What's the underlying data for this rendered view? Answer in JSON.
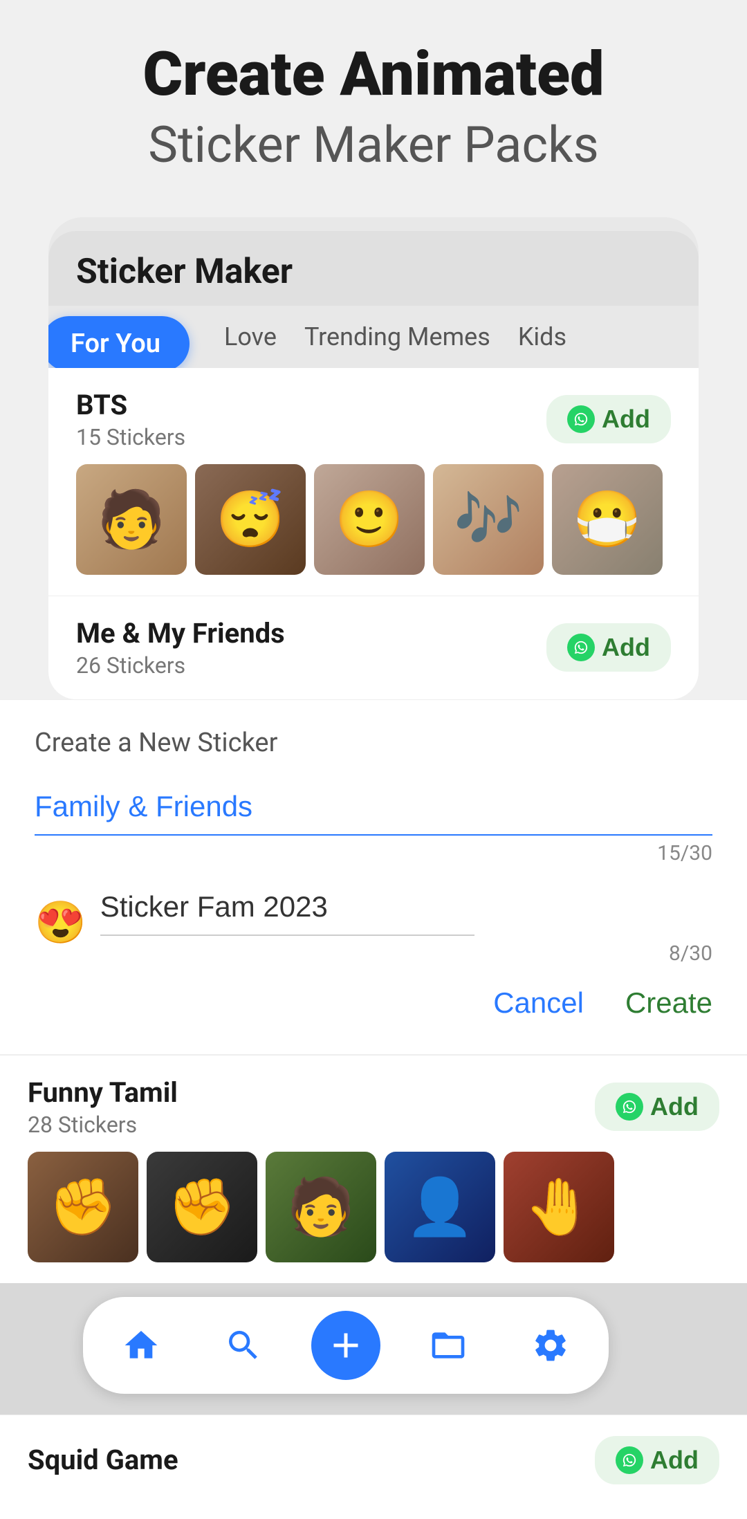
{
  "header": {
    "title_line1": "Create Animated",
    "title_line2": "Sticker Maker Packs"
  },
  "app": {
    "title": "Sticker Maker",
    "tabs": [
      {
        "id": "foryou",
        "label": "For You",
        "active": true
      },
      {
        "id": "love",
        "label": "Love",
        "active": false
      },
      {
        "id": "trending",
        "label": "Trending Memes",
        "active": false
      },
      {
        "id": "kids",
        "label": "Kids",
        "active": false
      }
    ]
  },
  "packs": [
    {
      "id": "bts",
      "name": "BTS",
      "count": "15 Stickers",
      "add_label": "Add",
      "stickers": [
        "face1",
        "face2",
        "face3",
        "face4",
        "face5"
      ]
    },
    {
      "id": "me-friends",
      "name": "Me & My Friends",
      "count": "26 Stickers",
      "add_label": "Add"
    },
    {
      "id": "funny-tamil",
      "name": "Funny Tamil",
      "count": "28 Stickers",
      "add_label": "Add",
      "stickers": [
        "face6",
        "face7",
        "face8",
        "face9",
        "face10"
      ]
    },
    {
      "id": "squid-game",
      "name": "Squid Game",
      "count": "",
      "add_label": "Add"
    }
  ],
  "modal": {
    "title": "Create a New Sticker",
    "pack_name_label": "Family & Friends",
    "pack_name_value": "Family & Friends",
    "pack_name_counter": "15/30",
    "sticker_name_label": "Sticker Fam 2023",
    "sticker_name_value": "Sticker Fam 2023",
    "sticker_name_counter": "8/30",
    "emoji": "😍",
    "cancel_label": "Cancel",
    "create_label": "Create"
  },
  "bottom_nav": {
    "items": [
      {
        "id": "home",
        "label": "Home",
        "active": true
      },
      {
        "id": "search",
        "label": "Search",
        "active": false
      },
      {
        "id": "add",
        "label": "Add",
        "active": false
      },
      {
        "id": "packs",
        "label": "Packs",
        "active": false
      },
      {
        "id": "settings",
        "label": "Settings",
        "active": false
      }
    ]
  }
}
